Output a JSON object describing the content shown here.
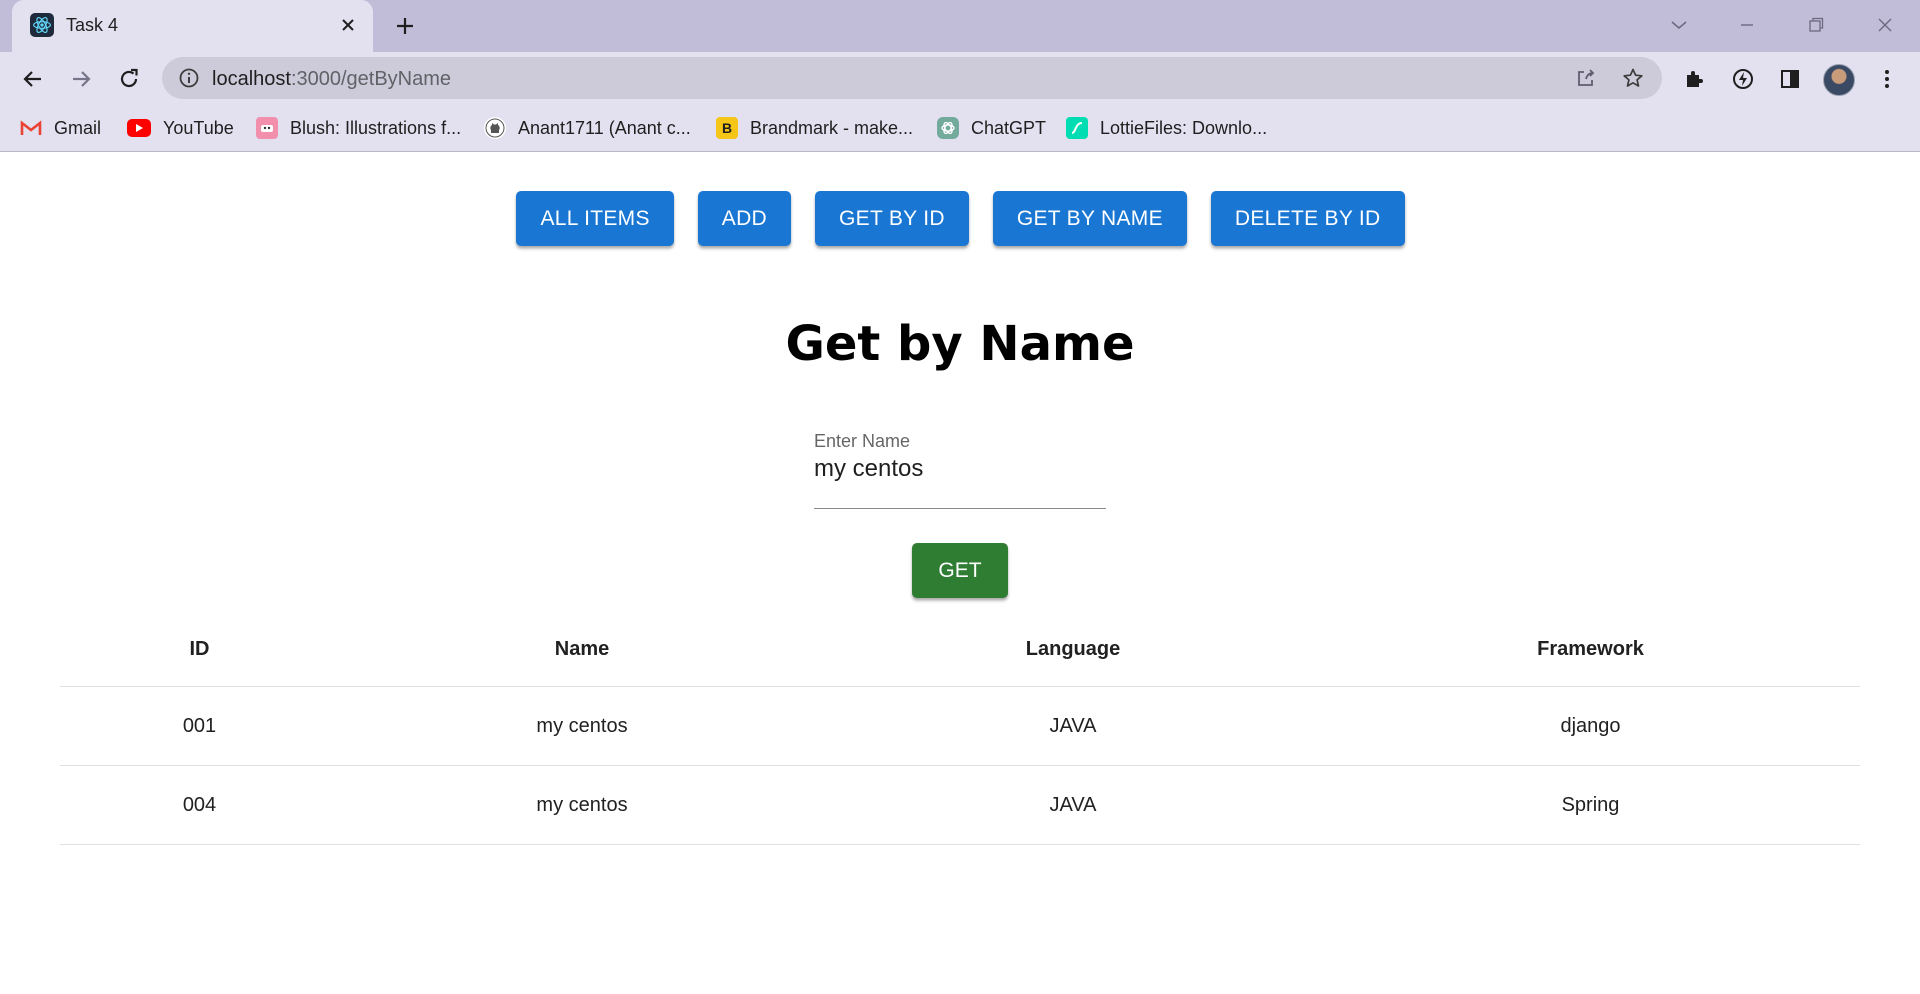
{
  "browser": {
    "tab": {
      "title": "Task 4",
      "favicon": "react-icon"
    },
    "url": {
      "host": "localhost",
      "path": ":3000/getByName"
    },
    "bookmarks": [
      {
        "label": "Gmail",
        "icon": "gmail-icon",
        "color": "#ea4335"
      },
      {
        "label": "YouTube",
        "icon": "youtube-icon",
        "color": "#ff0000"
      },
      {
        "label": "Blush: Illustrations f...",
        "icon": "blush-icon",
        "color": "#f28fad"
      },
      {
        "label": "Anant1711 (Anant c...",
        "icon": "github-icon",
        "color": "#ffffff"
      },
      {
        "label": "Brandmark - make...",
        "icon": "brandmark-icon",
        "color": "#f5c518"
      },
      {
        "label": "ChatGPT",
        "icon": "chatgpt-icon",
        "color": "#74aa9c"
      },
      {
        "label": "LottieFiles: Downlo...",
        "icon": "lottiefiles-icon",
        "color": "#00ddb3"
      }
    ]
  },
  "nav": {
    "buttons": [
      "ALL ITEMS",
      "ADD",
      "GET BY ID",
      "GET BY NAME",
      "DELETE BY ID"
    ],
    "color": "#1976d2"
  },
  "page": {
    "title": "Get by Name"
  },
  "form": {
    "label": "Enter Name",
    "value": "my centos",
    "submit_label": "GET",
    "submit_color": "#2e7d32"
  },
  "table": {
    "headers": [
      "ID",
      "Name",
      "Language",
      "Framework"
    ],
    "rows": [
      [
        "001",
        "my centos",
        "JAVA",
        "django"
      ],
      [
        "004",
        "my centos",
        "JAVA",
        "Spring"
      ]
    ]
  }
}
